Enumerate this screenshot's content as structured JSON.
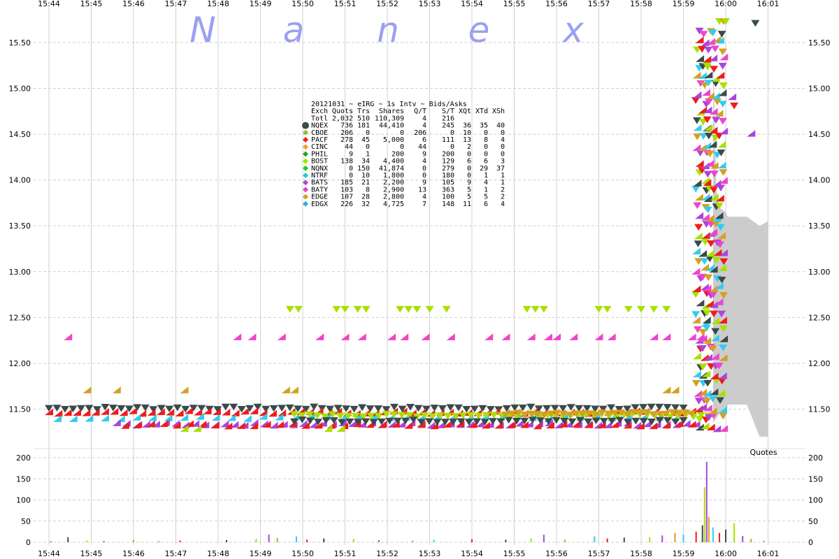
{
  "chart_data": {
    "type": "scatter",
    "watermark": [
      "N",
      "a",
      "n",
      "e",
      "x"
    ],
    "time_ticks": [
      "15:44",
      "15:45",
      "15:46",
      "15:47",
      "15:48",
      "15:49",
      "15:50",
      "15:51",
      "15:52",
      "15:53",
      "15:54",
      "15:55",
      "15:56",
      "15:57",
      "15:58",
      "15:59",
      "16:00",
      "16:01"
    ],
    "price_axis": {
      "ticks": [
        "11.50",
        "12.00",
        "12.50",
        "13.00",
        "13.50",
        "14.00",
        "14.50",
        "15.00",
        "15.50"
      ],
      "ylim": [
        11.1,
        15.85
      ]
    },
    "volume_axis": {
      "ticks": [
        "0",
        "50",
        "100",
        "150",
        "200"
      ],
      "ylim": [
        0,
        200
      ],
      "label": "Quotes"
    },
    "legend": {
      "title": "20121031 ~ eIRG ~ 1s Intv ~ Bids/Asks",
      "columns": [
        "Exch",
        "Quots",
        "Trs",
        "Shares",
        "Q/T",
        "S/T",
        "XQt",
        "XTd",
        "XSh"
      ],
      "rows": [
        {
          "exch": "Totl",
          "quots": "2,032",
          "trs": "510",
          "shares": "110,309",
          "qt": "4",
          "st": "216",
          "xqt": "",
          "xtd": "",
          "xsh": "",
          "color": ""
        },
        {
          "exch": "NQEX",
          "quots": "736",
          "trs": "181",
          "shares": "44,410",
          "qt": "4",
          "st": "245",
          "xqt": "36",
          "xtd": "35",
          "xsh": "40",
          "color": "#3a4a4a"
        },
        {
          "exch": "CBOE",
          "quots": "206",
          "trs": "0",
          "shares": "0",
          "qt": "206",
          "st": "0",
          "xqt": "10",
          "xtd": "0",
          "xsh": "0",
          "color": "#8cbc2c"
        },
        {
          "exch": "PACF",
          "quots": "278",
          "trs": "45",
          "shares": "5,000",
          "qt": "6",
          "st": "111",
          "xqt": "13",
          "xtd": "8",
          "xsh": "4",
          "color": "#ee1c1c"
        },
        {
          "exch": "CINC",
          "quots": "44",
          "trs": "0",
          "shares": "0",
          "qt": "44",
          "st": "0",
          "xqt": "2",
          "xtd": "0",
          "xsh": "0",
          "color": "#f0a020"
        },
        {
          "exch": "PHIL",
          "quots": "9",
          "trs": "1",
          "shares": "200",
          "qt": "9",
          "st": "200",
          "xqt": "0",
          "xtd": "0",
          "xsh": "0",
          "color": "#2ca02c"
        },
        {
          "exch": "BOST",
          "quots": "138",
          "trs": "34",
          "shares": "4,400",
          "qt": "4",
          "st": "129",
          "xqt": "6",
          "xtd": "6",
          "xsh": "3",
          "color": "#a8e000"
        },
        {
          "exch": "NQNX",
          "quots": "0",
          "trs": "150",
          "shares": "41,874",
          "qt": "0",
          "st": "279",
          "xqt": "0",
          "xtd": "29",
          "xsh": "37",
          "color": "#22cc22"
        },
        {
          "exch": "NTRF",
          "quots": "0",
          "trs": "10",
          "shares": "1,800",
          "qt": "0",
          "st": "180",
          "xqt": "0",
          "xtd": "1",
          "xsh": "1",
          "color": "#22cccc"
        },
        {
          "exch": "BATS",
          "quots": "185",
          "trs": "21",
          "shares": "2,200",
          "qt": "9",
          "st": "105",
          "xqt": "9",
          "xtd": "4",
          "xsh": "1",
          "color": "#aa44dd"
        },
        {
          "exch": "BATY",
          "quots": "103",
          "trs": "8",
          "shares": "2,900",
          "qt": "13",
          "st": "363",
          "xqt": "5",
          "xtd": "1",
          "xsh": "2",
          "color": "#dd44cc"
        },
        {
          "exch": "EDGE",
          "quots": "107",
          "trs": "28",
          "shares": "2,800",
          "qt": "4",
          "st": "100",
          "xqt": "5",
          "xtd": "5",
          "xsh": "2",
          "color": "#d4a020"
        },
        {
          "exch": "EDGX",
          "quots": "226",
          "trs": "32",
          "shares": "4,725",
          "qt": "7",
          "st": "148",
          "xqt": "11",
          "xtd": "6",
          "xsh": "4",
          "color": "#33aadd"
        }
      ]
    },
    "colors": {
      "NQEX": "#3a4a4a",
      "PACF": "#ee1c1c",
      "BOST": "#a8e000",
      "BATS": "#aa44dd",
      "BATY": "#ee44cc",
      "EDGE": "#d4a020",
      "EDGX": "#33ccee",
      "CBOE": "#8cbc2c",
      "spread": "#cccccc"
    },
    "quote_bands": [
      {
        "exch": "NQEX",
        "dir": "down",
        "t0": 0.0,
        "t1": 15.0,
        "price": 11.5,
        "n": 80
      },
      {
        "exch": "PACF",
        "dir": "up",
        "t0": 0.0,
        "t1": 15.2,
        "price": 11.46,
        "n": 70
      },
      {
        "exch": "EDGX",
        "dir": "up",
        "t0": 0.2,
        "t1": 14.8,
        "price": 11.4,
        "n": 40
      },
      {
        "exch": "BATS",
        "dir": "up",
        "t0": 1.6,
        "t1": 15.3,
        "price": 11.33,
        "n": 60
      },
      {
        "exch": "PACF",
        "dir": "up",
        "t0": 1.8,
        "t1": 15.2,
        "price": 11.32,
        "n": 45
      },
      {
        "exch": "BOST",
        "dir": "down",
        "t0": 5.8,
        "t1": 15.6,
        "price": 11.42,
        "n": 55
      },
      {
        "exch": "NQEX",
        "dir": "down",
        "t0": 5.8,
        "t1": 15.0,
        "price": 11.36,
        "n": 50
      },
      {
        "exch": "EDGE",
        "dir": "down",
        "t0": 10.8,
        "t1": 15.2,
        "price": 11.44,
        "n": 30
      }
    ],
    "bid_points": [
      {
        "exch": "BOST",
        "dir": "down",
        "t": [
          5.7,
          5.9,
          6.8,
          7.0,
          7.3,
          7.5,
          8.3,
          8.5,
          8.7,
          9.0,
          9.4,
          11.3,
          11.5,
          11.7,
          13.0,
          13.2,
          13.7,
          14.0,
          14.3,
          14.6
        ],
        "price": 12.58
      },
      {
        "exch": "BATY",
        "dir": "up",
        "t": [
          0.45,
          4.45,
          4.8,
          5.5,
          6.4,
          7.0,
          7.4,
          8.1,
          8.4,
          8.9,
          9.5,
          10.4,
          10.8,
          11.4,
          11.8,
          12.0,
          12.4,
          13.0,
          13.3,
          14.3,
          14.6,
          15.2,
          15.4
        ],
        "price": 12.28
      },
      {
        "exch": "EDGE",
        "dir": "up",
        "t": [
          0.9,
          1.6,
          3.2,
          5.6,
          5.8,
          14.6,
          14.8
        ],
        "price": 11.7
      },
      {
        "exch": "BOST",
        "dir": "up",
        "t": [
          3.2,
          3.5,
          6.6,
          6.9
        ],
        "price": 11.28
      }
    ],
    "spike": [
      {
        "exch": "BOST",
        "dir": "down",
        "t": 15.85,
        "price": 15.72
      },
      {
        "exch": "EDGE",
        "dir": "down",
        "t": 15.95,
        "price": 15.72
      },
      {
        "exch": "BOST",
        "dir": "down",
        "t": 16.0,
        "price": 15.72
      },
      {
        "exch": "NQEX",
        "dir": "down",
        "t": 16.7,
        "price": 15.7
      },
      {
        "exch": "PACF",
        "dir": "down",
        "t": 16.2,
        "price": 14.8
      },
      {
        "exch": "BATS",
        "dir": "up",
        "t": 16.15,
        "price": 14.9
      },
      {
        "exch": "BATS",
        "dir": "up",
        "t": 16.6,
        "price": 14.5
      }
    ],
    "spread_fill": [
      {
        "t": 15.7,
        "lo": 11.35,
        "hi": 15.35
      },
      {
        "t": 15.78,
        "lo": 11.4,
        "hi": 13.9
      },
      {
        "t": 15.85,
        "lo": 11.45,
        "hi": 13.7
      },
      {
        "t": 16.0,
        "lo": 11.45,
        "hi": 13.65
      },
      {
        "t": 16.05,
        "lo": 11.55,
        "hi": 13.6
      },
      {
        "t": 16.5,
        "lo": 11.55,
        "hi": 13.6
      },
      {
        "t": 16.8,
        "lo": 11.2,
        "hi": 13.5
      },
      {
        "t": 17.0,
        "lo": 11.2,
        "hi": 13.55
      }
    ],
    "volume_bars": [
      {
        "t": 0.05,
        "v": 2
      },
      {
        "t": 0.45,
        "v": 12
      },
      {
        "t": 0.9,
        "v": 4
      },
      {
        "t": 1.3,
        "v": 3
      },
      {
        "t": 2.0,
        "v": 5
      },
      {
        "t": 2.6,
        "v": 3
      },
      {
        "t": 3.1,
        "v": 4
      },
      {
        "t": 4.2,
        "v": 5
      },
      {
        "t": 4.9,
        "v": 8
      },
      {
        "t": 5.2,
        "v": 18
      },
      {
        "t": 5.4,
        "v": 10
      },
      {
        "t": 5.85,
        "v": 14
      },
      {
        "t": 6.1,
        "v": 6
      },
      {
        "t": 6.5,
        "v": 9
      },
      {
        "t": 7.2,
        "v": 8
      },
      {
        "t": 7.8,
        "v": 5
      },
      {
        "t": 8.6,
        "v": 4
      },
      {
        "t": 9.1,
        "v": 6
      },
      {
        "t": 10.0,
        "v": 7
      },
      {
        "t": 10.8,
        "v": 6
      },
      {
        "t": 11.4,
        "v": 9
      },
      {
        "t": 11.7,
        "v": 18
      },
      {
        "t": 12.2,
        "v": 6
      },
      {
        "t": 12.9,
        "v": 14
      },
      {
        "t": 13.2,
        "v": 9
      },
      {
        "t": 13.6,
        "v": 11
      },
      {
        "t": 14.2,
        "v": 12
      },
      {
        "t": 14.5,
        "v": 16
      },
      {
        "t": 14.8,
        "v": 22
      },
      {
        "t": 15.0,
        "v": 18
      },
      {
        "t": 15.3,
        "v": 25
      },
      {
        "t": 15.45,
        "v": 40
      },
      {
        "t": 15.5,
        "v": 130
      },
      {
        "t": 15.55,
        "v": 190
      },
      {
        "t": 15.6,
        "v": 60
      },
      {
        "t": 15.7,
        "v": 35
      },
      {
        "t": 15.85,
        "v": 22
      },
      {
        "t": 16.0,
        "v": 30
      },
      {
        "t": 16.2,
        "v": 45
      },
      {
        "t": 16.4,
        "v": 15
      },
      {
        "t": 16.6,
        "v": 8
      },
      {
        "t": 16.9,
        "v": 4
      }
    ]
  }
}
